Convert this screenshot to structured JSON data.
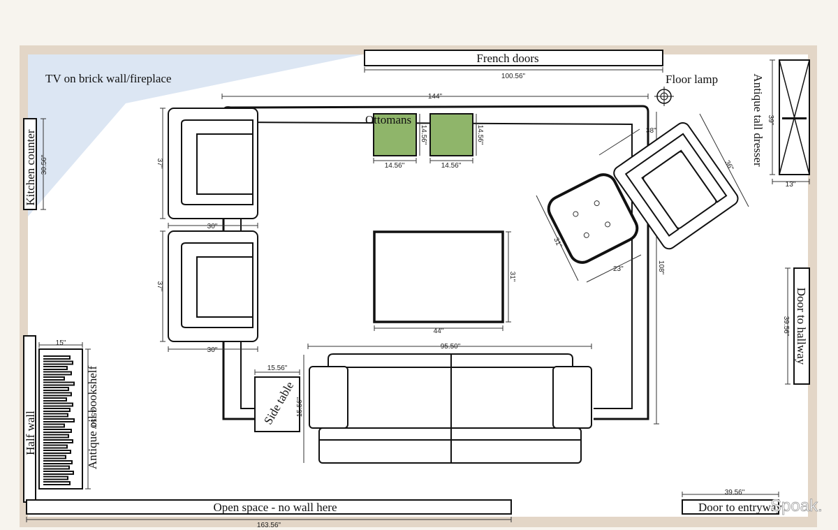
{
  "labels": {
    "french_doors": "French doors",
    "tv": "TV on brick wall/fireplace",
    "floor_lamp": "Floor lamp",
    "kitchen_counter": "Kitchen counter",
    "ottomans": "Ottomans",
    "antique_dresser": "Antique tall dresser",
    "door_hallway": "Door to hallway",
    "half_wall": "Half wall",
    "bookshelf": "Antique oil bookshelf",
    "side_table": "Side table",
    "open_space": "Open space - no wall here",
    "door_entryway": "Door to entryway"
  },
  "dims": {
    "french_doors": "100.56\"",
    "rug_width": "144\"",
    "rug_height": "108\"",
    "chair1_h": "37\"",
    "chair1_w": "30\"",
    "chair2_h": "37\"",
    "chair2_w": "30\"",
    "kitchen": "30.56\"",
    "ottoman1_w": "14.56\"",
    "ottoman1_h": "14.56\"",
    "ottoman2_w": "14.56\"",
    "ottoman2_h": "14.56\"",
    "coffee_w": "44\"",
    "coffee_h": "31\"",
    "sofa_w": "95.50\"",
    "side_w": "15.56\"",
    "side_h": "15.56\"",
    "recliner_w": "38\"",
    "recliner_h": "36\"",
    "pouf_w": "23\"",
    "pouf_h": "31\"",
    "dresser_w": "13\"",
    "dresser_h": "39\"",
    "hallway": "39.56\"",
    "bookshelf_w": "15\"",
    "bookshelf_h": "45.50\"",
    "room_w": "163.56\"",
    "entry": "39.56\""
  },
  "watermark": "Spoak.",
  "colors": {
    "wall": "#e3d6c7",
    "tv_wedge": "#dce6f3",
    "ottoman": "#8fb56a",
    "line": "#111111"
  }
}
